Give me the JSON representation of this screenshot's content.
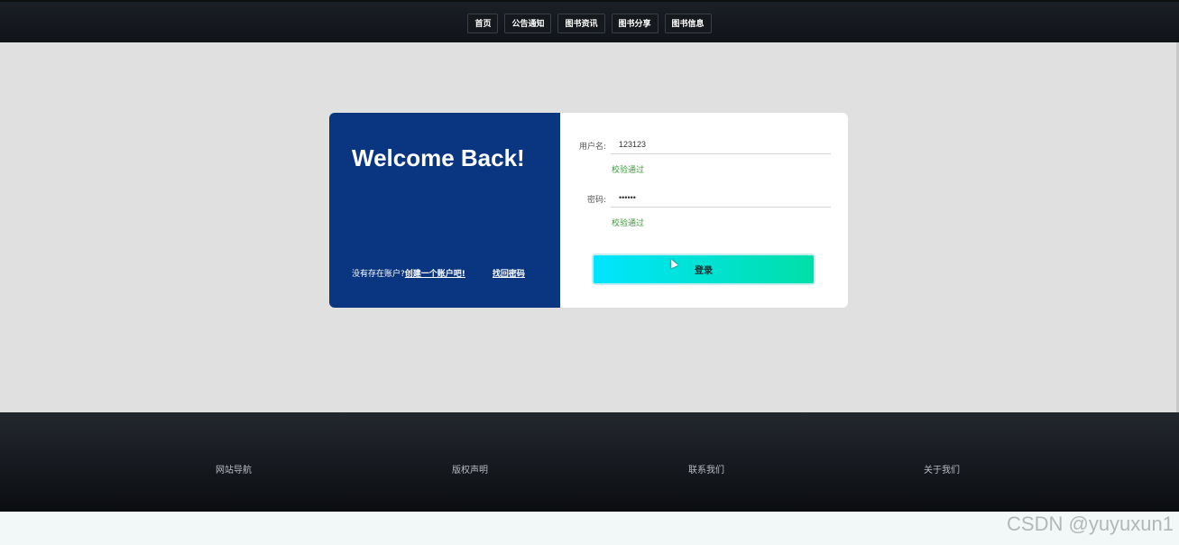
{
  "nav": {
    "items": [
      {
        "label": "首页"
      },
      {
        "label": "公告通知"
      },
      {
        "label": "图书资讯"
      },
      {
        "label": "图书分享"
      },
      {
        "label": "图书信息"
      }
    ]
  },
  "login": {
    "welcome": "Welcome Back!",
    "no_account_text": "没有存在账户?",
    "create_account_link": "创建一个账户吧!",
    "forgot_password_link": "找回密码",
    "username_label": "用户名:",
    "username_value": "123123",
    "username_valid": "校验通过",
    "password_label": "密码:",
    "password_value": "••••••",
    "password_valid": "校验通过",
    "login_button": "登录"
  },
  "footer": {
    "items": [
      {
        "label": "网站导航"
      },
      {
        "label": "版权声明"
      },
      {
        "label": "联系我们"
      },
      {
        "label": "关于我们"
      }
    ]
  },
  "watermark": "CSDN @yuyuxun1",
  "colors": {
    "nav_bg": "#15181d",
    "card_left_bg": "#0a3580",
    "valid_text": "#3c9a3c",
    "button_gradient_start": "#00e5ff",
    "button_gradient_end": "#00dfa8",
    "main_bg": "#e0e0e0"
  }
}
